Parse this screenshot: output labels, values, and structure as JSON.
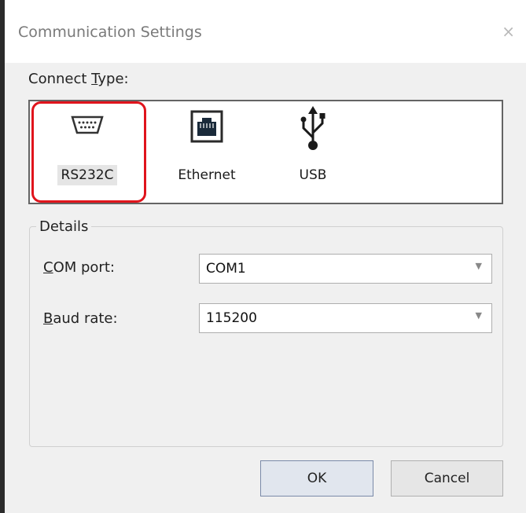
{
  "window": {
    "title": "Communication Settings",
    "close_glyph": "×"
  },
  "connect_type": {
    "label_prefix": "Connect ",
    "label_accel": "T",
    "label_suffix": "ype:",
    "items": [
      {
        "label": "RS232C",
        "icon": "serial-port-icon",
        "selected": true
      },
      {
        "label": "Ethernet",
        "icon": "ethernet-port-icon",
        "selected": false
      },
      {
        "label": "USB",
        "icon": "usb-icon",
        "selected": false
      }
    ],
    "highlight_color": "#e0141c"
  },
  "details": {
    "legend": "Details",
    "com_port": {
      "label_accel": "C",
      "label_rest": "OM port:",
      "value": "COM1"
    },
    "baud_rate": {
      "label_accel": "B",
      "label_rest": "aud rate:",
      "value": "115200"
    },
    "dropdown_arrow": "▼"
  },
  "buttons": {
    "ok": "OK",
    "cancel": "Cancel"
  }
}
